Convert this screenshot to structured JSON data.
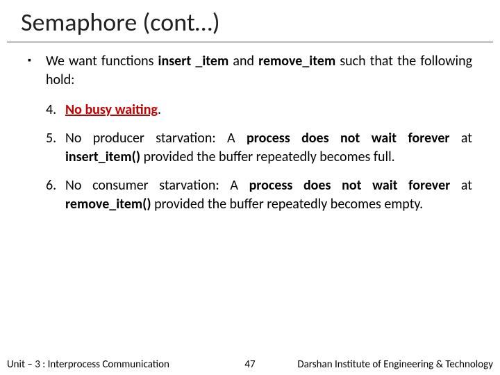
{
  "title": "Semaphore (cont…)",
  "intro": {
    "pre": "We want functions ",
    "f1": "insert _item",
    "mid": " and ",
    "f2": "remove_item",
    "post": " such that the following hold:"
  },
  "items": [
    {
      "num": "4.",
      "pre": "",
      "bold": "No busy waiting",
      "post": "."
    },
    {
      "num": "5.",
      "pre": "No producer starvation: A ",
      "bold": "process does not wait forever",
      "mid": " at ",
      "bold2": "insert_item()",
      "post": " provided the buffer repeatedly becomes full."
    },
    {
      "num": "6.",
      "pre": "No consumer starvation: A ",
      "bold": "process does not wait forever",
      "mid": " at ",
      "bold2": "remove_item()",
      "post": " provided the buffer repeatedly becomes empty."
    }
  ],
  "footer": {
    "left": "Unit – 3 : Interprocess Communication",
    "num": "47",
    "right": "Darshan Institute of Engineering & Technology"
  }
}
